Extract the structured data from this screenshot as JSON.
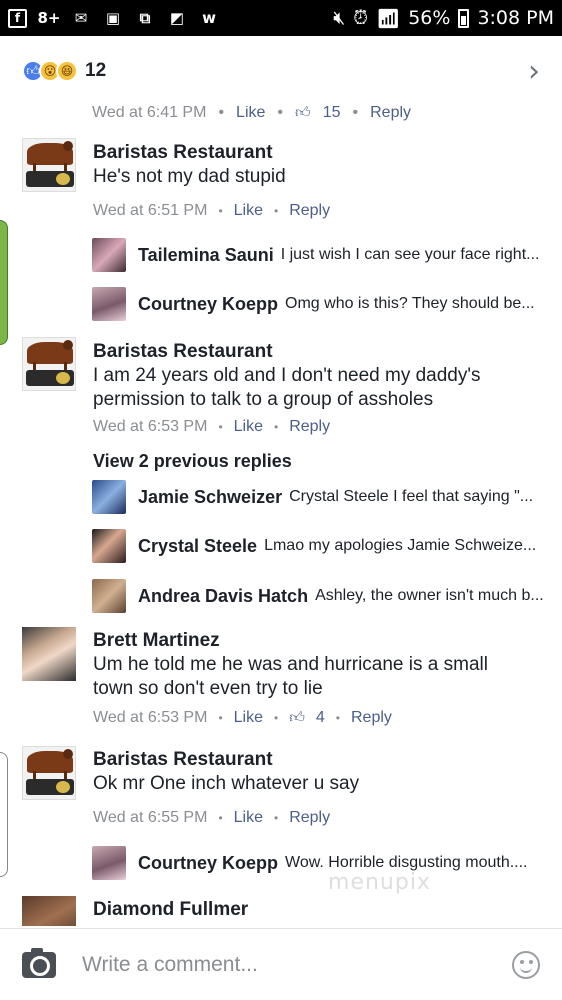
{
  "status_bar": {
    "left_icons": [
      "facebook-icon",
      "google-plus-icon",
      "mail-icon",
      "image-icon",
      "gallery-icon",
      "photo-icon",
      "w-app-icon"
    ],
    "left_glyphs": [
      "f",
      "8+",
      "✉",
      "▣",
      "⧉",
      "◩",
      "w"
    ],
    "battery": "56%",
    "time": "3:08 PM"
  },
  "header": {
    "reaction_count": "12"
  },
  "cut_comment": {
    "time": "Wed at 6:41 PM",
    "like": "Like",
    "like_count": "15",
    "reply": "Reply"
  },
  "comments": [
    {
      "name": "Baristas Restaurant",
      "text": "He's not my dad stupid",
      "time": "Wed at 6:51 PM",
      "like": "Like",
      "reply": "Reply",
      "replies": [
        {
          "name": "Tailemina Sauni",
          "text": "I just wish I can see your face right..."
        },
        {
          "name": "Courtney Koepp",
          "text": "Omg who is this? They should be..."
        }
      ]
    },
    {
      "name": "Baristas Restaurant",
      "text": "I am 24 years old and I don't need my daddy's permission to talk to a group of assholes",
      "time": "Wed at 6:53 PM",
      "like": "Like",
      "reply": "Reply",
      "view_previous": "View 2 previous replies",
      "replies": [
        {
          "name": "Jamie Schweizer",
          "text": "Crystal Steele I feel that saying \"..."
        },
        {
          "name": "Crystal Steele",
          "text": "Lmao my apologies Jamie Schweize..."
        },
        {
          "name": "Andrea Davis Hatch",
          "text": "Ashley, the owner isn't much b..."
        }
      ]
    },
    {
      "name": "Brett Martinez",
      "text": "Um he told me he was and hurricane is a small town so don't even try to lie",
      "time": "Wed at 6:53 PM",
      "like": "Like",
      "like_count": "4",
      "reply": "Reply"
    },
    {
      "name": "Baristas Restaurant",
      "text": "Ok mr One inch whatever u say",
      "time": "Wed at 6:55 PM",
      "like": "Like",
      "reply": "Reply",
      "replies": [
        {
          "name": "Courtney Koepp",
          "text": "Wow. Horrible disgusting mouth...."
        }
      ]
    },
    {
      "name": "Diamond Fullmer"
    }
  ],
  "watermark": "menupix",
  "composer": {
    "placeholder": "Write a comment..."
  }
}
